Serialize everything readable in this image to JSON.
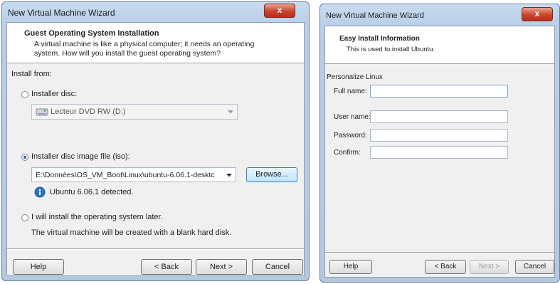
{
  "left_window": {
    "title": "New Virtual Machine Wizard",
    "close_glyph": "x",
    "header_title": "Guest Operating System Installation",
    "header_sub_1": "A virtual machine is like a physical computer; it needs an operating",
    "header_sub_2": "system. How will you install the guest operating system?",
    "install_from_label": "Install from:",
    "opt_disc_label": "Installer disc:",
    "disc_value": "Lecteur DVD RW (D:)",
    "opt_iso_label": "Installer disc image file (iso):",
    "iso_value": "E:\\Données\\OS_VM_Boot\\Linux\\ubuntu-6.06.1-desktc",
    "browse_label": "Browse...",
    "detected_text": "Ubuntu 6.06.1 detected.",
    "opt_later_label": "I will install the operating system later.",
    "later_note": "The virtual machine will be created with a blank hard disk.",
    "help_label": "Help",
    "back_label": "< Back",
    "next_label": "Next >",
    "cancel_label": "Cancel",
    "selected_option": "iso"
  },
  "right_window": {
    "title": "New Virtual Machine Wizard",
    "close_glyph": "x",
    "header_title": "Easy Install Information",
    "header_sub": "This is used to install Ubuntu.",
    "section_label": "Personalize Linux",
    "full_name_label": "Full name:",
    "full_name_value": "",
    "user_name_label": "User name:",
    "user_name_value": "",
    "password_label": "Password:",
    "password_value": "",
    "confirm_label": "Confirm:",
    "confirm_value": "",
    "help_label": "Help",
    "back_label": "< Back",
    "next_label": "Next >",
    "cancel_label": "Cancel"
  },
  "icons": {
    "dvd": "dvd-drive-icon",
    "info": "info-icon",
    "dropdown": "chevron-down-icon",
    "close": "close-icon"
  }
}
